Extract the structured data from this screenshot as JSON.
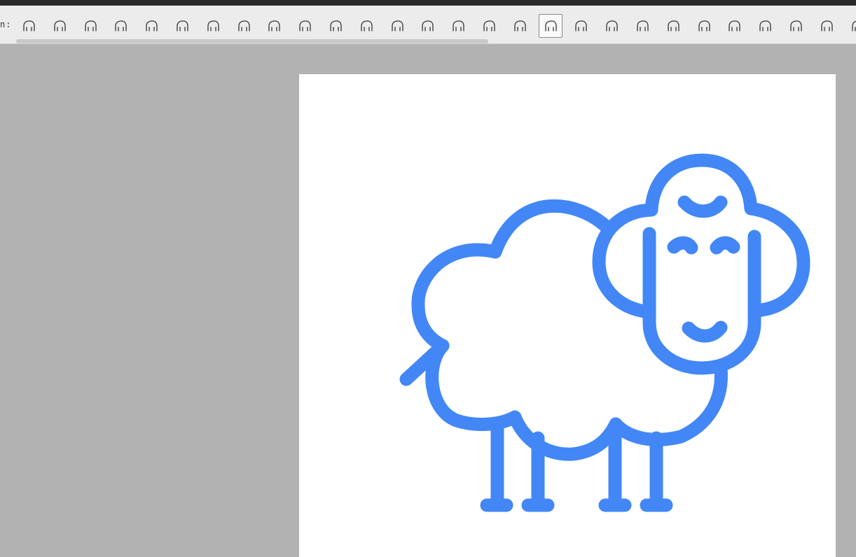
{
  "toolbar": {
    "label": "n:",
    "selected_index": 17,
    "icons": [
      "elephant-icon",
      "elephant-front-icon",
      "deer-icon",
      "doghouse-icon",
      "kennel-icon",
      "doghouse-round-icon",
      "dog-bed-icon",
      "dog-basket-icon",
      "pet-cushion-icon",
      "dachshund-icon",
      "greyhound-icon",
      "bulldog-face-icon",
      "small-dog-icon",
      "llama-icon",
      "camel-head-icon",
      "alpaca-icon",
      "paw-prints-icon",
      "sheep-icon",
      "lion-face-icon",
      "gingerbread-icon",
      "panda-icon",
      "teddy-bear-icon",
      "polar-bear-face-icon",
      "polar-bear-icon",
      "bear-face-icon",
      "meerkat-icon",
      "squirrel-icon",
      "animal-icon"
    ]
  },
  "canvas": {
    "artwork": "sheep-icon",
    "stroke_color": "#4287f5",
    "background": "#ffffff"
  },
  "colors": {
    "workspace": "#b2b2b2",
    "toolbar_bg": "#ececec",
    "topbar": "#2b2b2b"
  }
}
